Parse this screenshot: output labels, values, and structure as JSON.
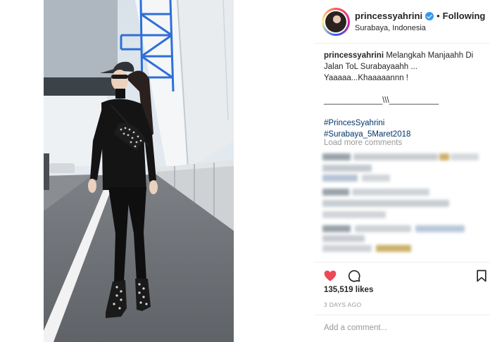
{
  "post": {
    "username": "princessyahrini",
    "follow_label": "Following",
    "location": "Surabaya, Indonesia",
    "caption": {
      "username": "princessyahrini",
      "lines": [
        "Melangkah Manjaahh Di",
        "Jalan ToL Surabayaahh ...",
        "Yaaaaa...Khaaaaannn !",
        "_____________\\\\\\___________"
      ],
      "hashtags": [
        "#PrincesSyahrini",
        "#Surabaya_5Maret2018"
      ]
    },
    "load_more": "Load more comments",
    "likes": "135,519 likes",
    "time": "3 DAYS AGO",
    "comment_placeholder": "Add a comment..."
  },
  "icons": {
    "verified": "verified-badge-icon",
    "like": "heart-icon",
    "comment": "comment-bubble-icon",
    "save": "bookmark-icon"
  },
  "colors": {
    "heart": "#ed4956",
    "hashtag": "#003569",
    "verified": "#3897f0",
    "muted": "#999999"
  }
}
